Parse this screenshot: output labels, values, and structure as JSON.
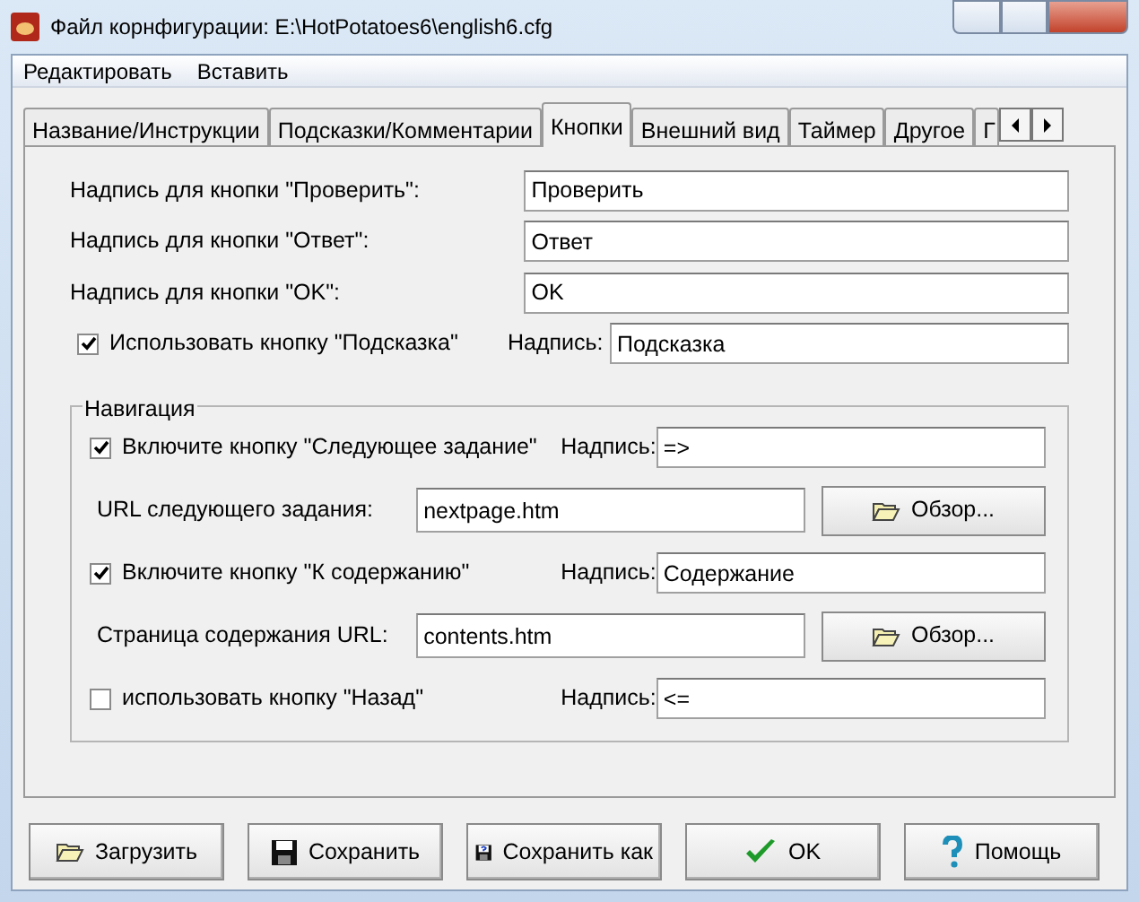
{
  "window": {
    "title": "Файл корнфигурации: E:\\HotPotatoes6\\english6.cfg"
  },
  "menu": [
    "Редактировать",
    "Вставить"
  ],
  "tabs": [
    {
      "label": "Название/Инструкции",
      "selected": false
    },
    {
      "label": "Подсказки/Комментарии",
      "selected": false
    },
    {
      "label": "Кнопки",
      "selected": true
    },
    {
      "label": "Внешний вид",
      "selected": false
    },
    {
      "label": "Таймер",
      "selected": false
    },
    {
      "label": "Другое",
      "selected": false
    },
    {
      "label": "Г",
      "selected": false
    }
  ],
  "fields": [
    {
      "label": "Надпись для кнопки \"Проверить\":",
      "value": "Проверить"
    },
    {
      "label": "Надпись для кнопки \"Ответ\":",
      "value": "Ответ"
    },
    {
      "label": "Надпись для кнопки \"OK\":",
      "value": "OK"
    }
  ],
  "hint": {
    "label": "Использовать кнопку \"Подсказка\"",
    "checked": true,
    "caption_label": "Надпись:",
    "caption": "Подсказка"
  },
  "navigation": {
    "title": "Навигация",
    "items": [
      {
        "label": "Включите кнопку \"Следующее задание\"",
        "checked": true,
        "caption_label": "Надпись:",
        "caption": "=>",
        "url_label": "URL следующего задания:",
        "url": "nextpage.htm",
        "browse": "Обзор..."
      },
      {
        "label": "Включите кнопку \"К содержанию\"",
        "checked": true,
        "caption_label": "Надпись:",
        "caption": "Содержание",
        "url_label": "Страница содержания URL:",
        "url": "contents.htm",
        "browse": "Обзор..."
      },
      {
        "label": "использовать кнопку \"Назад\"",
        "checked": false,
        "caption_label": "Надпись:",
        "caption": "<="
      }
    ]
  },
  "buttons": [
    {
      "label": "Загрузить",
      "kind": "open"
    },
    {
      "label": "Сохранить",
      "kind": "save"
    },
    {
      "label": "Сохранить как",
      "kind": "save-as"
    },
    {
      "label": "OK",
      "kind": "ok"
    },
    {
      "label": "Помощь",
      "kind": "help"
    }
  ]
}
